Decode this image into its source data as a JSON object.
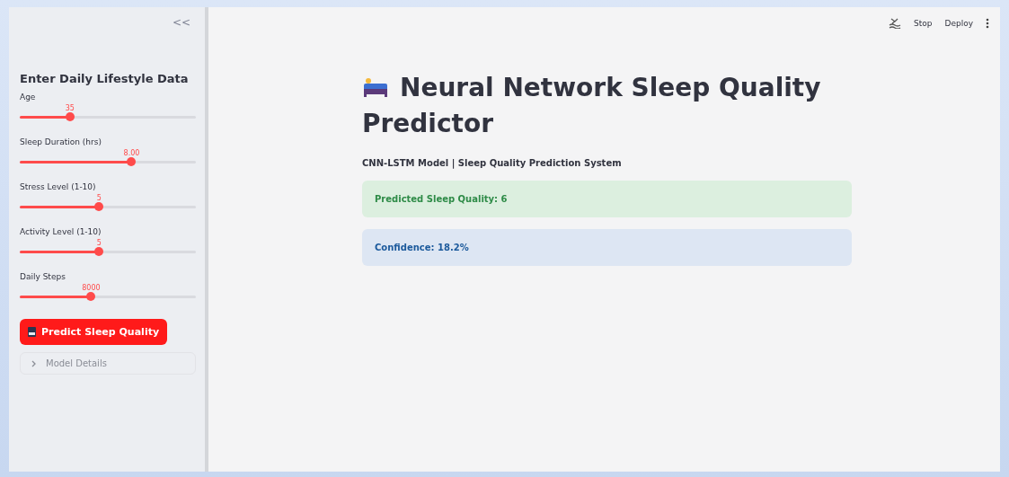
{
  "sidebar": {
    "collapse": "<<",
    "heading": "Enter Daily Lifestyle Data",
    "sliders": [
      {
        "label": "Age",
        "reading": "35",
        "level": 0.285
      },
      {
        "label": "Sleep Duration (hrs)",
        "reading": "8.00",
        "level": 0.635
      },
      {
        "label": "Stress Level (1-10)",
        "reading": "5",
        "level": 0.45
      },
      {
        "label": "Activity Level (1-10)",
        "reading": "5",
        "level": 0.45
      },
      {
        "label": "Daily Steps",
        "reading": "8000",
        "level": 0.405
      }
    ],
    "button": "Predict Sleep Quality",
    "expander": {
      "label": "Model Details",
      "expanded": false
    }
  },
  "toolbar": {
    "buttons": [
      "Stop",
      "Deploy"
    ]
  },
  "main": {
    "title": "Neural Network Sleep Quality Predictor",
    "subtitle": "CNN-LSTM Model | Sleep Quality Prediction System",
    "alerts": [
      {
        "kind": "success",
        "text": "Predicted Sleep Quality: 6"
      },
      {
        "kind": "info",
        "text": "Confidence: 18.2%"
      }
    ]
  }
}
